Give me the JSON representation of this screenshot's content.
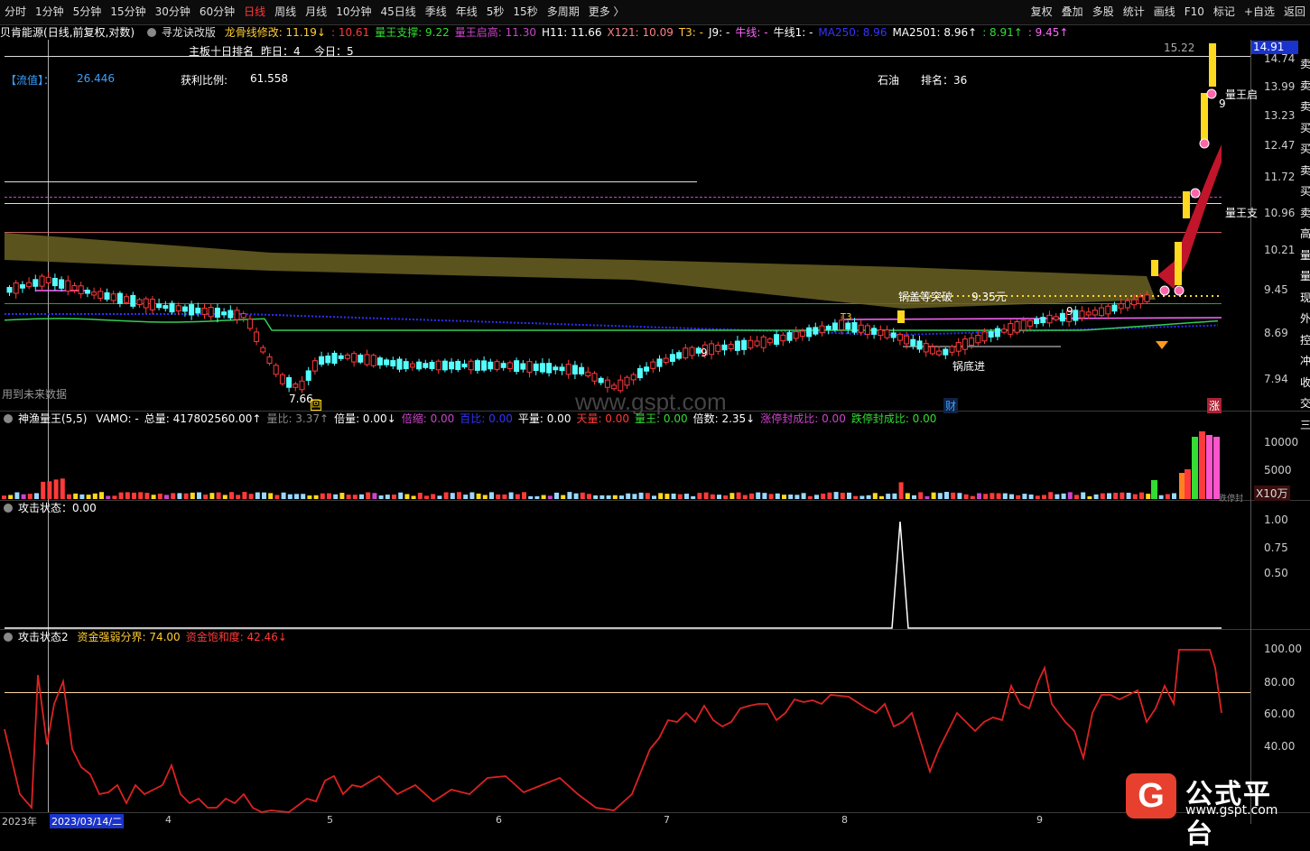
{
  "toolbar": {
    "left": [
      "分时",
      "1分钟",
      "5分钟",
      "15分钟",
      "30分钟",
      "60分钟",
      "日线",
      "周线",
      "月线",
      "10分钟",
      "45日线",
      "季线",
      "年线",
      "5秒",
      "15秒",
      "多周期",
      "更多 〉"
    ],
    "active": "日线",
    "right": [
      "复权",
      "叠加",
      "多股",
      "统计",
      "画线",
      "F10",
      "标记",
      "+自选",
      "返回"
    ]
  },
  "main_header": {
    "stock": "贝肯能源",
    "mode": "(日线,前复权,对数)",
    "indicator": "寻龙诀改版",
    "items": [
      {
        "t": "龙骨线修改: 11.19↓",
        "c": "#ffcc33"
      },
      {
        "t": ": 10.61",
        "c": "#ff3a3a"
      },
      {
        "t": "量王支撑: 9.22",
        "c": "#33dd33"
      },
      {
        "t": "量王启高: 11.30",
        "c": "#cc44cc"
      },
      {
        "t": "H11: 11.66",
        "c": "#ffffff"
      },
      {
        "t": "X121: 10.09",
        "c": "#ff8080"
      },
      {
        "t": "T3: -",
        "c": "#ffcc33"
      },
      {
        "t": "J9: -",
        "c": "#ffffff"
      },
      {
        "t": "牛线: -",
        "c": "#ff66ff"
      },
      {
        "t": "牛线1: -",
        "c": "#ffffff"
      },
      {
        "t": "MA250: 8.96",
        "c": "#3333ff"
      },
      {
        "t": "MA2501: 8.96↑",
        "c": "#ffffff"
      },
      {
        "t": ": 8.91↑",
        "c": "#33dd33"
      },
      {
        "t": ": 9.45↑",
        "c": "#ff66ff"
      }
    ]
  },
  "subhead": {
    "rank_label": "主板十日排名",
    "yesterday": "昨日：4",
    "today": "今日：5",
    "liuzhi_label": "【流值】：",
    "liuzhi": "26.446",
    "profit_label": "获利比例:",
    "profit": "61.558",
    "sector": "石油",
    "rank": "排名：36"
  },
  "price_axis": [
    "14.74",
    "13.99",
    "13.23",
    "12.47",
    "11.72",
    "10.96",
    "10.21",
    "9.45",
    "8.69",
    "7.94"
  ],
  "current_price": "14.91",
  "top_price": "15.22",
  "chart_annotations": {
    "future_data": "用到未来数据",
    "low_price": "7.66",
    "breakout": "锅盖等突破",
    "breakout_price": "9.35元",
    "bottom_entry": "锅底进",
    "cai": "财",
    "zhang": "涨",
    "king_label1": "量王启",
    "king_label2": "量王支",
    "nine1": "9",
    "nine2": "9",
    "nine3": "9",
    "t3": "T3",
    "watermark": "www.gspt.com",
    "hui": "回"
  },
  "right_edge_chars": [
    "卖",
    "卖",
    "卖",
    "买",
    "买",
    "卖",
    "买",
    "卖",
    "高",
    "量",
    "量",
    "现",
    "外",
    "控",
    "冲",
    "收",
    "交",
    "三"
  ],
  "vol_header": {
    "name": "神渔量王(5,5)",
    "items": [
      {
        "t": "VAMO: -",
        "c": "#ffffff"
      },
      {
        "t": "总量: 417802560.00↑",
        "c": "#ffffff"
      },
      {
        "t": "量比: 3.37↑",
        "c": "#888888"
      },
      {
        "t": "倍量: 0.00↓",
        "c": "#ffffff"
      },
      {
        "t": "倍缩: 0.00",
        "c": "#cc44cc"
      },
      {
        "t": "百比: 0.00",
        "c": "#3333ff"
      },
      {
        "t": "平量: 0.00",
        "c": "#ffffff"
      },
      {
        "t": "天量: 0.00",
        "c": "#ff3a3a"
      },
      {
        "t": "量王: 0.00",
        "c": "#33dd33"
      },
      {
        "t": "倍数: 2.35↓",
        "c": "#ffffff"
      },
      {
        "t": "涨停封成比: 0.00",
        "c": "#cc44cc"
      },
      {
        "t": "跌停封成比: 0.00",
        "c": "#33dd33"
      }
    ],
    "axis": [
      "10000",
      "5000"
    ],
    "unit": "X10万",
    "note": "跌停封"
  },
  "attack_header": {
    "name": "攻击状态",
    "value": "：0.00",
    "axis": [
      "1.00",
      "0.75",
      "0.50"
    ]
  },
  "attack2_header": {
    "name": "攻击状态2",
    "items": [
      {
        "t": "资金强弱分界: 74.00",
        "c": "#ffcc33"
      },
      {
        "t": "资金饱和度: 42.46↓",
        "c": "#ff3a3a"
      }
    ],
    "axis": [
      "100.00",
      "80.00",
      "60.00",
      "40.00"
    ]
  },
  "date_axis": {
    "first": "2023年",
    "selected": "2023/03/14/二",
    "months": [
      "4",
      "5",
      "6",
      "7",
      "8",
      "9"
    ]
  },
  "logo": {
    "mark": "G",
    "name": "公式平台",
    "url": "www.gspt.com"
  },
  "colors": {
    "up": "#ff3a3a",
    "down": "#54ffff",
    "yellow": "#ffd820",
    "ma250": "#2f2fff",
    "ma_green": "#33cc55",
    "fill": "#6b6222",
    "cloud_red": "#c0152a"
  }
}
